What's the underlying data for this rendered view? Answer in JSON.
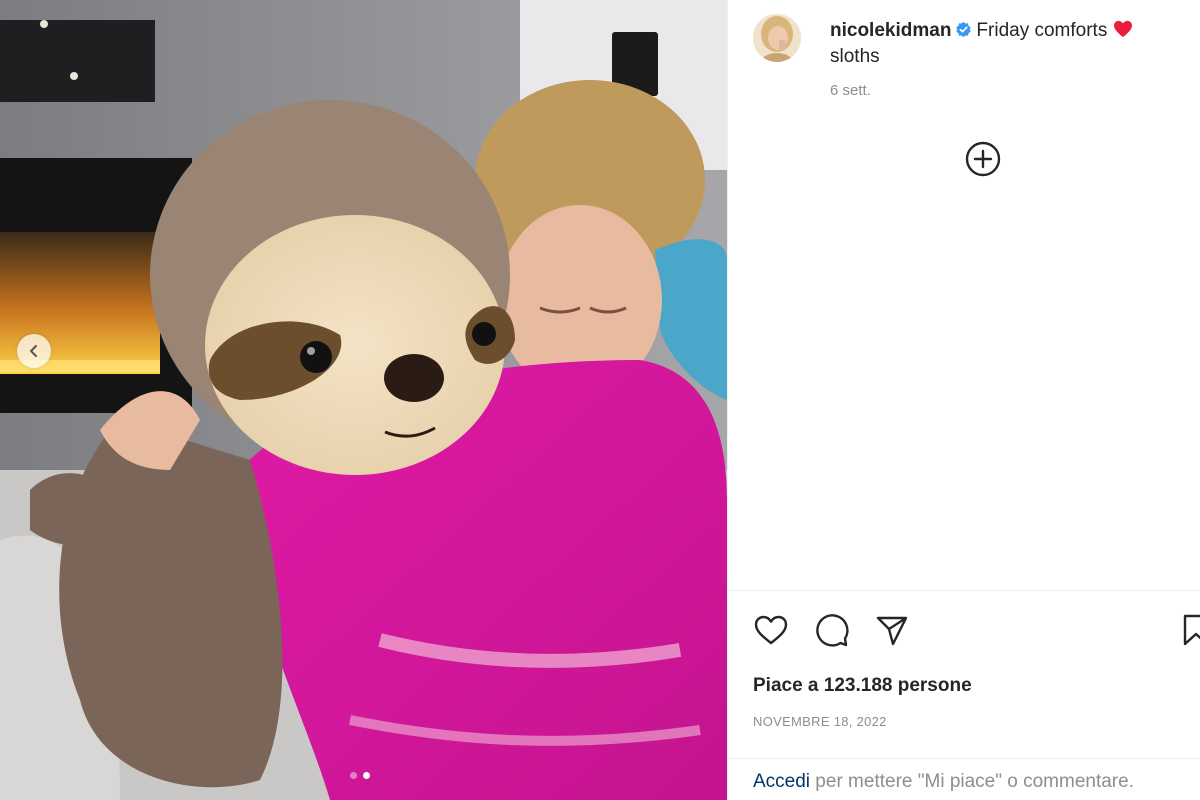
{
  "post": {
    "username": "nicolekidman",
    "caption_text": "Friday comforts",
    "caption_line2": "sloths",
    "time_ago": "6 sett.",
    "likes_text": "Piace a 123.188 persone",
    "date_text": "NOVEMBRE 18, 2022",
    "carousel": {
      "total_slides": 2,
      "active_slide": 2
    }
  },
  "footer": {
    "login_link": "Accedi",
    "login_rest": " per mettere \"Mi piace\" o commentare."
  },
  "icons": {
    "verified": "verified-badge-icon",
    "caption_heart": "red-heart-emoji-icon",
    "more_comments": "add-circle-icon",
    "like": "heart-outline-icon",
    "comment": "comment-bubble-icon",
    "share": "paper-plane-icon",
    "save": "bookmark-icon",
    "prev": "chevron-left-icon"
  },
  "colors": {
    "verified_blue": "#3897f0",
    "heart_red": "#ed1c3a",
    "link_blue": "#00376b",
    "secondary_text": "#8e8e8e"
  }
}
